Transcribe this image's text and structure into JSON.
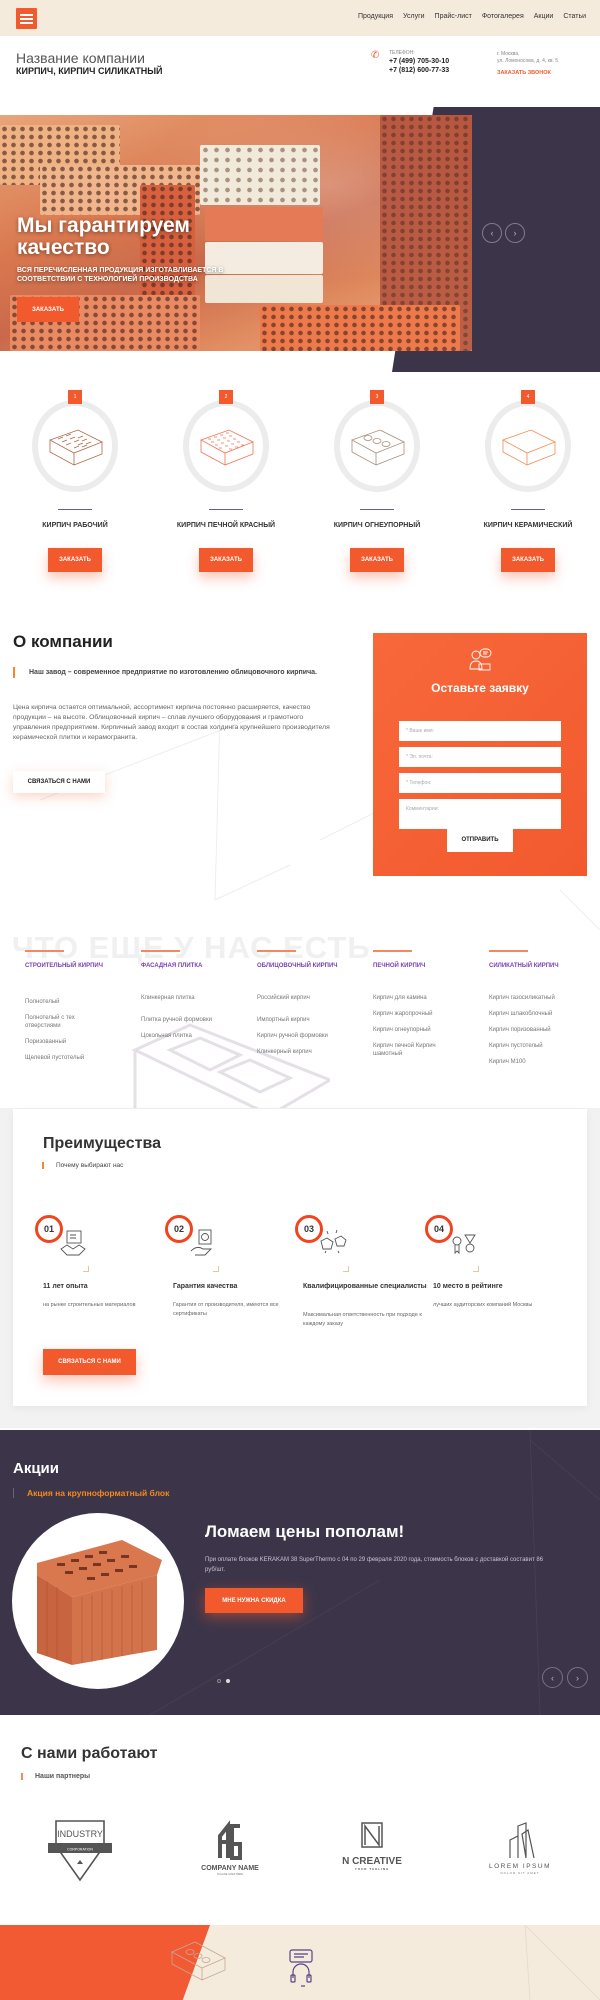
{
  "nav": {
    "menu_icon": "hamburger-icon",
    "items": [
      "Продукция",
      "Услуги",
      "Прайс-лист",
      "Фотогалерея",
      "Акции",
      "Статьи"
    ]
  },
  "header": {
    "company_name": "Название компании",
    "tagline": "КИРПИЧ, КИРПИЧ СИЛИКАТНЫЙ",
    "phone_label": "ТЕЛЕФОН:",
    "phones": [
      "+7 (499) 705-30-10",
      "+7 (812) 600-77-33"
    ],
    "address_city": "г. Москва,",
    "address_street": "ул. Ломоносова, д. 4, кв. 5",
    "callback_label": "ЗАКАЗАТЬ ЗВОНОК"
  },
  "hero": {
    "title_line1": "Мы гарантируем",
    "title_line2": "качество",
    "subtitle_line1": "ВСЯ ПЕРЕЧИСЛЕННАЯ ПРОДУКЦИЯ ИЗГОТАВЛИВАЕТСЯ В",
    "subtitle_line2": "СООТВЕТСТВИИ С ТЕХНОЛОГИЕЙ ПРОИЗВОДСТВА",
    "button_label": "ЗАКАЗАТЬ",
    "prev_icon": "‹",
    "next_icon": "›"
  },
  "products": [
    {
      "num": "1",
      "name": "КИРПИЧ РАБОЧИЙ",
      "button": "ЗАКАЗАТЬ",
      "color": "#b0694a"
    },
    {
      "num": "2",
      "name": "КИРПИЧ ПЕЧНОЙ КРАСНЫЙ",
      "button": "ЗАКАЗАТЬ",
      "color": "#f07050"
    },
    {
      "num": "3",
      "name": "КИРПИЧ ОГНЕУПОРНЫЙ",
      "button": "ЗАКАЗАТЬ",
      "color": "#a8907e"
    },
    {
      "num": "4",
      "name": "КИРПИЧ КЕРАМИЧЕСКИЙ",
      "button": "ЗАКАЗАТЬ",
      "color": "#f28a50"
    }
  ],
  "about": {
    "title": "О компании",
    "quote": "Наш завод – современное предприятие по изготовлению облицовочного кирпича.",
    "text": "Цена кирпича остается оптимальной, ассортимент кирпича постоянно расширяется, качество продукции – на высоте. Облицовочный кирпич – сплав лучшего оборудования и грамотного управления предприятием. Кирпичный завод входит в состав холдинга крупнейшего производителя керамической плитки и керамогранита.",
    "button_label": "СВЯЗАТЬСЯ С НАМИ"
  },
  "form": {
    "title": "Оставьте заявку",
    "fields": [
      {
        "placeholder": "* Ваше имя:",
        "value": ""
      },
      {
        "placeholder": "* Эл. почта:",
        "value": ""
      },
      {
        "placeholder": "* Телефон:",
        "value": ""
      },
      {
        "placeholder": "Комментарии:",
        "value": ""
      }
    ],
    "submit_label": "ОТПРАВИТЬ"
  },
  "catalog": {
    "background_title": "ЧТО ЕЩЕ У НАС ЕСТЬ",
    "columns": [
      {
        "title": "СТРОИТЕЛЬНЫЙ КИРПИЧ",
        "items": [
          "Полнотелый",
          "Полнотелый с тех отверстиями",
          "Поризованный",
          "Щелевой пустотелый"
        ]
      },
      {
        "title": "ФАСАДНАЯ ПЛИТКА",
        "items": [
          "Клинкерная плитка",
          "Плитка ручной формовки",
          "Цокольная плитка"
        ]
      },
      {
        "title": "ОБЛИЦОВОЧНЫЙ КИРПИЧ",
        "items": [
          "Российский кирпич",
          "Импортный кирпич",
          "Кирпич ручной формовки",
          "Клинкерный кирпич"
        ]
      },
      {
        "title": "ПЕЧНОЙ КИРПИЧ",
        "items": [
          "Кирпич для камина",
          "Кирпич жаропрочный",
          "Кирпич огнеупорный",
          "Кирпич печной Кирпич шамотный"
        ]
      },
      {
        "title": "СИЛИКАТНЫЙ КИРПИЧ",
        "items": [
          "Кирпич газосиликатный",
          "Кирпич шлакоблочный",
          "Кирпич поризованный",
          "Кирпич пустотелый",
          "Кирпич М100"
        ]
      }
    ]
  },
  "advantages": {
    "title": "Преимущества",
    "subtitle": "Почему выбирают нас",
    "items": [
      {
        "num": "01",
        "icon": "handshake-certificate-icon",
        "title": "11 лет опыта",
        "desc": "на рынке строительных материалов"
      },
      {
        "num": "02",
        "icon": "quality-guarantee-icon",
        "title": "Гарантия качества",
        "desc": "Гарантия от производителя, имеются все сертификаты"
      },
      {
        "num": "03",
        "icon": "specialists-icon",
        "title": "Квалифицированные специалисты",
        "desc": "Максимальная ответственность при подходе к каждому заказу"
      },
      {
        "num": "04",
        "icon": "rating-medal-icon",
        "title": "10 место в рейтинге",
        "desc": "лучших аудиторских компаний Москвы"
      }
    ],
    "button_label": "СВЯЗАТЬСЯ С НАМИ"
  },
  "promo": {
    "title": "Акции",
    "subtitle": "Акция на крупноформатный блок",
    "headline": "Ломаем цены пополам!",
    "text": "При оплате блоков KERAKAM 38 SuperThermo с 04 по 29 февраля 2020 года, стоимость блоков с доставкой составит 86 руб/шт.",
    "button_label": "МНЕ НУЖНА СКИДКА",
    "slides_total": 2,
    "active_slide": 2,
    "prev_icon": "‹",
    "next_icon": "›"
  },
  "partners": {
    "title": "С нами работают",
    "subtitle": "Наши партнеры",
    "logos": [
      {
        "name": "INDUSTRY",
        "sub": "CORPORATION"
      },
      {
        "name": "COMPANY NAME",
        "sub": "TAGLINE GOES HERE",
        "mark": "AG"
      },
      {
        "name": "N CREATIVE",
        "sub": "YOUR TAGLINE"
      },
      {
        "name": "LOREM IPSUM",
        "sub": "DOLOR SIT AMET"
      }
    ]
  },
  "colors": {
    "accent": "#f25a2e",
    "dark": "#3c3549",
    "beige": "#f5ebdd",
    "purple": "#7a3fb0"
  }
}
